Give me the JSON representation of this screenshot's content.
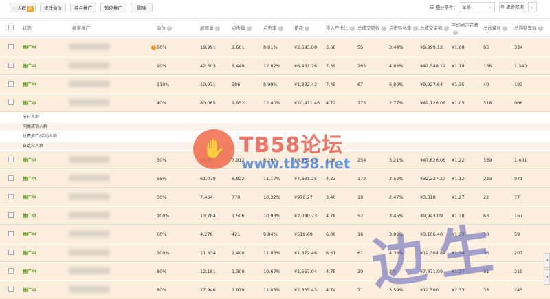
{
  "toolbar": {
    "add_crowd_label": "+ 人群",
    "add_crowd_badge": "新",
    "edit_bid_label": "修改溢价",
    "join_promo_label": "参与推广",
    "pause_promo_label": "暂停推广",
    "delete_label": "删除",
    "filter_label": "细分条件：",
    "filter_value": "全部",
    "more_data_label": "更多数据",
    "expand_icon": "chevron-down-icon"
  },
  "columns": [
    "状态",
    "搜索推广",
    "溢价",
    "展现量",
    "点击量",
    "点击率",
    "花费",
    "投入产出比",
    "总成交笔数",
    "点击转化率",
    "总成交金额",
    "平均点击花费",
    "总收藏数",
    "总购物车数"
  ],
  "rows_top": [
    {
      "status": "推广中",
      "bid": "80%",
      "warn": true,
      "impressions": "19,991",
      "clicks": "1,601",
      "ctr": "8.01%",
      "cost": "¥2,693.08",
      "roi": "3.68",
      "orders": "55",
      "cvr": "3.44%",
      "gmv": "¥9,899.12",
      "cpc": "¥1.68",
      "fav": "86",
      "cart": "334"
    },
    {
      "status": "推广中",
      "bid": "90%",
      "warn": false,
      "impressions": "42,503",
      "clicks": "5,449",
      "ctr": "12.82%",
      "cost": "¥6,431.76",
      "roi": "7.39",
      "orders": "265",
      "cvr": "4.86%",
      "gmv": "¥47,548.12",
      "cpc": "¥1.18",
      "fav": "136",
      "cart": "1,340"
    },
    {
      "status": "推广中",
      "bid": "110%",
      "warn": false,
      "impressions": "10,971",
      "clicks": "986",
      "ctr": "8.99%",
      "cost": "¥1,332.42",
      "roi": "7.45",
      "orders": "67",
      "cvr": "6.80%",
      "gmv": "¥9,927.64",
      "cpc": "¥1.35",
      "fav": "40",
      "cart": "193"
    },
    {
      "status": "推广中",
      "bid": "40%",
      "warn": false,
      "impressions": "80,065",
      "clicks": "9,932",
      "ctr": "12.40%",
      "cost": "¥10,411.46",
      "roi": "4.72",
      "orders": "275",
      "cvr": "2.77%",
      "gmv": "¥49,126.08",
      "cpc": "¥1.05",
      "fav": "318",
      "cart": "966"
    }
  ],
  "groups": [
    "节日人群",
    "同类店铺人群",
    "付费推广/活动人群",
    "自定义人群"
  ],
  "rows_bottom": [
    {
      "status": "推广中",
      "bid": "50%",
      "warn": false,
      "impressions": "95,551",
      "clicks": "7,912",
      "ctr": "8.28%",
      "cost": "¥8,652.45",
      "roi": "4.98",
      "orders": "254",
      "cvr": "3.21%",
      "gmv": "¥47,626.06",
      "cpc": "¥1.22",
      "fav": "339",
      "cart": "1,401"
    },
    {
      "status": "推广中",
      "bid": "55%",
      "warn": false,
      "impressions": "61,078",
      "clicks": "6,822",
      "ctr": "11.17%",
      "cost": "¥7,621.25",
      "roi": "4.23",
      "orders": "172",
      "cvr": "2.52%",
      "gmv": "¥32,237.27",
      "cpc": "¥1.12",
      "fav": "223",
      "cart": "971"
    },
    {
      "status": "推广中",
      "bid": "50%",
      "warn": false,
      "impressions": "7,464",
      "clicks": "770",
      "ctr": "10.32%",
      "cost": "¥976.27",
      "roi": "3.40",
      "orders": "19",
      "cvr": "2.47%",
      "gmv": "¥3,318",
      "cpc": "¥1.27",
      "fav": "22",
      "cart": "77"
    },
    {
      "status": "推广中",
      "bid": "100%",
      "warn": false,
      "impressions": "13,784",
      "clicks": "1,506",
      "ctr": "10.93%",
      "cost": "¥2,080.73",
      "roi": "4.78",
      "orders": "52",
      "cvr": "3.45%",
      "gmv": "¥9,943.09",
      "cpc": "¥1.38",
      "fav": "63",
      "cart": "167"
    },
    {
      "status": "推广中",
      "bid": "60%",
      "warn": false,
      "impressions": "4,278",
      "clicks": "421",
      "ctr": "9.84%",
      "cost": "¥519.69",
      "roi": "6.09",
      "orders": "16",
      "cvr": "3.80%",
      "gmv": "¥3,166.40",
      "cpc": "¥1.23",
      "fav": "30",
      "cart": "59"
    },
    {
      "status": "推广中",
      "bid": "100%",
      "warn": false,
      "impressions": "11,834",
      "clicks": "1,400",
      "ctr": "11.83%",
      "cost": "¥1,872.46",
      "roi": "6.61",
      "orders": "61",
      "cvr": "4.36%",
      "gmv": "¥12,368.84",
      "cpc": "¥1.34",
      "fav": "36",
      "cart": "207"
    },
    {
      "status": "推广中",
      "bid": "80%",
      "warn": false,
      "impressions": "12,181",
      "clicks": "1,300",
      "ctr": "10.67%",
      "cost": "¥1,657.04",
      "roi": "4.75",
      "orders": "39",
      "cvr": "3%",
      "gmv": "¥7,871.99",
      "cpc": "¥1.27",
      "fav": "31",
      "cart": "219"
    },
    {
      "status": "推广中",
      "bid": "80%",
      "warn": false,
      "impressions": "17,946",
      "clicks": "1,979",
      "ctr": "11.03%",
      "cost": "¥2,635.43",
      "roi": "4.74",
      "orders": "71",
      "cvr": "3.59%",
      "gmv": "¥12,500",
      "cpc": "¥1.33",
      "fav": "33",
      "cart": "245"
    }
  ],
  "watermark": {
    "title": "TB58论坛",
    "url": "www.tb58.net",
    "seal": "边生",
    "hand_icon": "hand-icon"
  },
  "colors": {
    "row_bg": "#fbeedd",
    "status_green": "#5a9a1a",
    "warn_orange": "#f08a1b"
  }
}
